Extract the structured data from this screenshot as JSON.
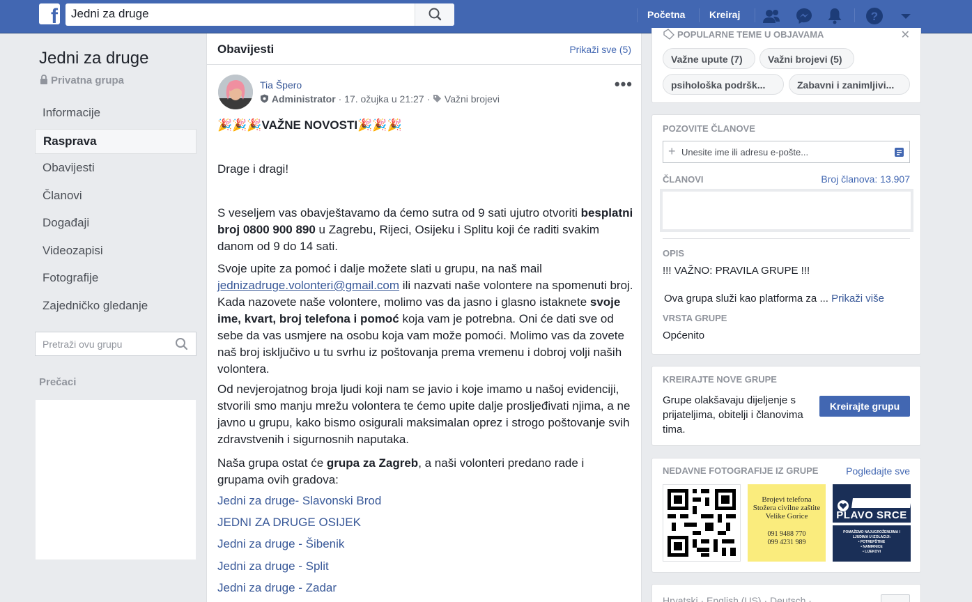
{
  "topbar": {
    "logo": "f",
    "search_value": "Jedni za druge",
    "nav_home": "Početna",
    "nav_create": "Kreiraj",
    "icons": [
      "friends-icon",
      "messenger-icon",
      "notifications-icon",
      "help-icon",
      "dropdown-icon"
    ]
  },
  "sidebar": {
    "group_name": "Jedni za druge",
    "privacy": "Privatna grupa",
    "items": [
      {
        "label": "Informacije"
      },
      {
        "label": "Rasprava"
      },
      {
        "label": "Obavijesti"
      },
      {
        "label": "Članovi"
      },
      {
        "label": "Događaji"
      },
      {
        "label": "Videozapisi"
      },
      {
        "label": "Fotografije"
      },
      {
        "label": "Zajedničko gledanje"
      }
    ],
    "active_index": 1,
    "search_placeholder": "Pretraži ovu grupu",
    "shortcuts_title": "Prečaci"
  },
  "feed": {
    "title": "Obavijesti",
    "show_all": "Prikaži sve (5)",
    "post": {
      "author": "Tia Špero",
      "role": "Administrator",
      "time": "17. ožujka u 21:27",
      "topic": "Važni brojevi",
      "headline": "VAŽNE NOVOSTI",
      "greeting": "Drage i dragi!",
      "p1_a": "S veseljem vas obavještavamo da ćemo sutra od 9 sati ujutro otvoriti ",
      "p1_bold": "besplatni broj 0800 900 890",
      "p1_b": " u Zagrebu, Rijeci, Osijeku i Splitu koji će raditi svakim danom od 9 do 14 sati.",
      "p2_a": "Svoje upite za pomoć i dalje možete slati u grupu, na naš mail ",
      "p2_link": "jednizadruge.volonteri@gmail.com",
      "p2_b": " ili nazvati naše volontere na spomenuti broj. Kada nazovete naše volontere, molimo vas da jasno i glasno istaknete ",
      "p2_bold": "svoje ime, kvart, broj telefona i pomoć",
      "p2_c": " koja vam je potrebna. Oni će dati sve od sebe da vas usmjere na osobu koja vam može pomoći. Molimo vas da zovete naš broj isključivo u tu svrhu iz poštovanja prema vremenu i dobroj volji naših volontera.",
      "p3": "Od nevjerojatnog broja ljudi koji nam se javio i koje imamo u našoj evidenciji, stvorili smo manju mrežu volontera te ćemo upite dalje prosljeđivati njima, a ne javno u grupu, kako bismo osigurali maksimalan oprez i strogo poštovanje svih zdravstvenih i sigurnosnih naputaka.",
      "p4_a": "Naša grupa ostat će ",
      "p4_bold": "grupa za Zagreb",
      "p4_b": ", a naši volonteri predano rade i grupama ovih gradova:",
      "links": [
        "Jedni za druge- Slavonski Brod",
        "JEDNI ZA DRUGE OSIJEK",
        "Jedni za druge - Šibenik",
        "Jedni za druge - Split",
        "Jedni za druge - Zadar"
      ]
    }
  },
  "right": {
    "topics_title": "POPULARNE TEME U OBJAVAMA",
    "topics": [
      "Važne upute (7)",
      "Važni brojevi (5)",
      "psihološka podršk...",
      "Zabavni i zanimljivi..."
    ],
    "invite_title": "POZOVITE ČLANOVE",
    "invite_placeholder": "Unesite ime ili adresu e-pošte...",
    "members_title": "ČLANOVI",
    "members_count": "Broj članova: 13.907",
    "desc_title": "OPIS",
    "desc_line1": "!!! VAŽNO: PRAVILA GRUPE !!!",
    "desc_line2": "Ova grupa služi kao platforma za ...",
    "desc_more": "Prikaži više",
    "type_title": "VRSTA GRUPE",
    "type_value": "Općenito",
    "create_title": "KREIRAJTE NOVE GRUPE",
    "create_text": "Grupe olakšavaju dijeljenje s prijateljima, obitelji i članovima tima.",
    "create_button": "Kreirajte grupu",
    "photos_title": "NEDAVNE FOTOGRAFIJE IZ GRUPE",
    "photos_link": "Pogledajte sve",
    "photo2_lines": [
      "Brojevi telefona",
      "Stožera civilne zaštite",
      "Velike Gorice",
      "091 9488 770",
      "099 4231 989"
    ],
    "photo3_title": "PLAVO SRCE",
    "photo3_sub": [
      "POMAŽEMO NAJUGROŽENIJIMA I",
      "LJUDIMA U IZOLACIJI:",
      "• POTREPŠTINE",
      "• NAMIRNICE",
      "• LIJEKOVI"
    ],
    "languages": "Hrvatski · English (US) · Deutsch ·"
  }
}
